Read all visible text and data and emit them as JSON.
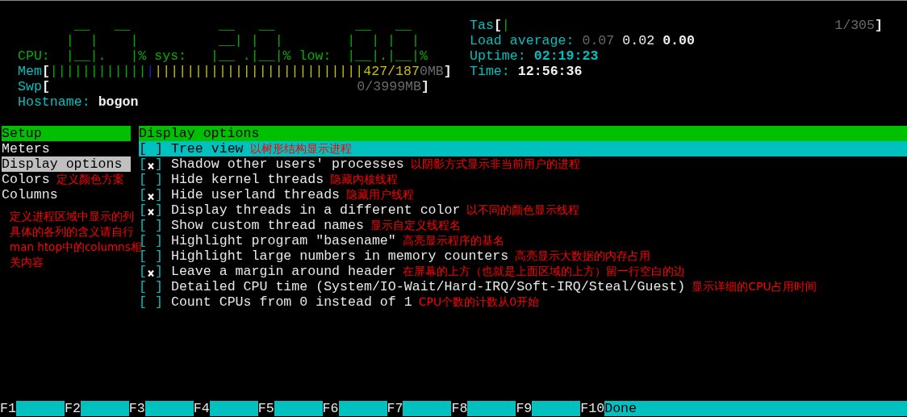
{
  "header": {
    "cpu_meter": {
      "lines": [
        "       __   __           __   __          __   __",
        "      |  |    |          __| |  |        |  | |  |",
        "CPU:  |__|.   |% sys:   |__ .|__|% low:  |__|.|__|%"
      ]
    },
    "mem": {
      "label": "Mem",
      "open": "[",
      "close": "]",
      "bars": [
        {
          "text": "||||||||||||",
          "kind": "used"
        },
        {
          "text": "|",
          "kind": "buffers"
        },
        {
          "text": "||||||||||||||||||||||||||",
          "kind": "cache"
        }
      ],
      "values": [
        {
          "text": "427/187",
          "kind": "cache"
        },
        {
          "text": "0MB",
          "kind": "dim"
        }
      ]
    },
    "swp": {
      "label": "Swp",
      "open": "[",
      "close": "]",
      "values": [
        {
          "text": "0/3999MB",
          "kind": "dim"
        }
      ]
    },
    "hostname": {
      "label": "Hostname:",
      "value": "bogon"
    },
    "tasks": {
      "label": "Tas",
      "open": "[",
      "close": "]",
      "bar": "|",
      "value": "1/305"
    },
    "load_average": {
      "label": "Load average:",
      "values": [
        {
          "text": "0.07",
          "kind": "dim"
        },
        {
          "text": "0.02",
          "kind": "normal"
        },
        {
          "text": "0.00",
          "kind": "bold"
        }
      ]
    },
    "uptime": {
      "label": "Uptime:",
      "value": "02:19:23"
    },
    "time": {
      "label": "Time:",
      "value": "12:56:36"
    }
  },
  "sidebar": {
    "title": "Setup",
    "items": [
      {
        "label": "Meters",
        "selected": false
      },
      {
        "label": "Display options",
        "selected": true
      },
      {
        "label": "Colors",
        "selected": false,
        "annotation": "定义颜色方案"
      },
      {
        "label": "Columns",
        "selected": false
      }
    ],
    "note_lines": [
      "定义进程区域中显示的列",
      "具体的各列的含义请自行",
      "man htop中的columns相",
      "关内容"
    ]
  },
  "checkbox": {
    "open": "[",
    "close": "]"
  },
  "panel": {
    "title": "Display options",
    "options": [
      {
        "label": "Tree view",
        "checked": false,
        "selected": true,
        "annotation": "以树形结构显示进程"
      },
      {
        "label": "Shadow other users' processes",
        "checked": true,
        "selected": false,
        "annotation": "以阴影方式显示非当前用户的进程"
      },
      {
        "label": "Hide kernel threads",
        "checked": false,
        "selected": false,
        "annotation": "隐藏内核线程"
      },
      {
        "label": "Hide userland threads",
        "checked": true,
        "selected": false,
        "annotation": "隐藏用户线程"
      },
      {
        "label": "Display threads in a different color",
        "checked": true,
        "selected": false,
        "annotation": "以不同的颜色显示线程"
      },
      {
        "label": "Show custom thread names",
        "checked": false,
        "selected": false,
        "annotation": "显示自定义线程名"
      },
      {
        "label": "Highlight program \"basename\"",
        "checked": false,
        "selected": false,
        "annotation": "高亮显示程序的基名"
      },
      {
        "label": "Highlight large numbers in memory counters",
        "checked": false,
        "selected": false,
        "annotation": "高亮显示大数据的内存占用"
      },
      {
        "label": "Leave a margin around header",
        "checked": true,
        "selected": false,
        "annotation": "在屏幕的上方（也就是上面区域的上方）留一行空白的边"
      },
      {
        "label": "Detailed CPU time (System/IO-Wait/Hard-IRQ/Soft-IRQ/Steal/Guest)",
        "checked": false,
        "selected": false,
        "annotation": "显示详细的CPU占用时间"
      },
      {
        "label": "Count CPUs from 0 instead of 1",
        "checked": false,
        "selected": false,
        "annotation": "CPU个数的计数从0开始"
      }
    ]
  },
  "function_bar": [
    {
      "key": "F1"
    },
    {
      "key": "F2"
    },
    {
      "key": "F3"
    },
    {
      "key": "F4"
    },
    {
      "key": "F5"
    },
    {
      "key": "F6"
    },
    {
      "key": "F7"
    },
    {
      "key": "F8"
    },
    {
      "key": "F9"
    },
    {
      "key": "F10",
      "label": "Done"
    }
  ]
}
